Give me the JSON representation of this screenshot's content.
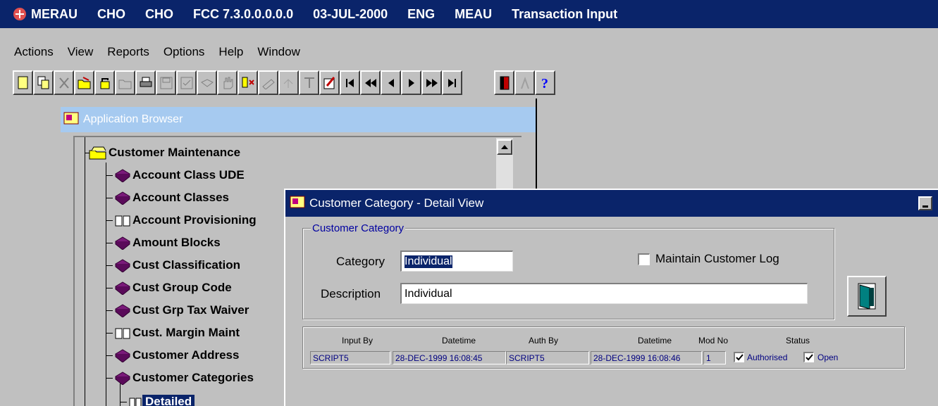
{
  "titlebar": {
    "items": [
      "MERAU",
      "CHO",
      "CHO",
      "FCC 7.3.0.0.0.0.0",
      "03-JUL-2000",
      "ENG",
      "MEAU",
      "Transaction Input"
    ]
  },
  "menu": {
    "items": [
      "Actions",
      "View",
      "Reports",
      "Options",
      "Help",
      "Window"
    ]
  },
  "app_browser": {
    "title": "Application Browser",
    "root": "Customer Maintenance",
    "items": [
      {
        "label": "Account Class UDE",
        "icon": "book-icon"
      },
      {
        "label": "Account Classes",
        "icon": "book-icon"
      },
      {
        "label": "Account Provisioning",
        "icon": "open-book-icon"
      },
      {
        "label": "Amount Blocks",
        "icon": "book-icon"
      },
      {
        "label": "Cust Classification",
        "icon": "book-icon"
      },
      {
        "label": "Cust Group Code",
        "icon": "book-icon"
      },
      {
        "label": "Cust Grp Tax Waiver",
        "icon": "book-icon"
      },
      {
        "label": "Cust. Margin Maint",
        "icon": "open-book-icon"
      },
      {
        "label": "Customer Address",
        "icon": "book-icon"
      },
      {
        "label": "Customer Categories",
        "icon": "book-icon"
      }
    ],
    "sub_item": "Detailed"
  },
  "detail": {
    "title": "Customer Category - Detail View",
    "group_label": "Customer Category",
    "category_label": "Category",
    "category_value": "Individual",
    "maintain_log_label": "Maintain Customer Log",
    "maintain_log_checked": false,
    "description_label": "Description",
    "description_value": "Individual"
  },
  "audit": {
    "headers": {
      "input_by": "Input By",
      "datetime1": "Datetime",
      "auth_by": "Auth By",
      "datetime2": "Datetime",
      "mod_no": "Mod No",
      "status": "Status"
    },
    "input_by": "SCRIPT5",
    "datetime1": "28-DEC-1999 16:08:45",
    "auth_by": "SCRIPT5",
    "datetime2": "28-DEC-1999 16:08:46",
    "mod_no": "1",
    "authorised_label": "Authorised",
    "open_label": "Open",
    "authorised_checked": true,
    "open_checked": true
  },
  "colors": {
    "titlebar": "#0a246a",
    "inactive_title": "#a6caf0",
    "face": "#c0c0c0",
    "book": "#7a1a7a"
  }
}
